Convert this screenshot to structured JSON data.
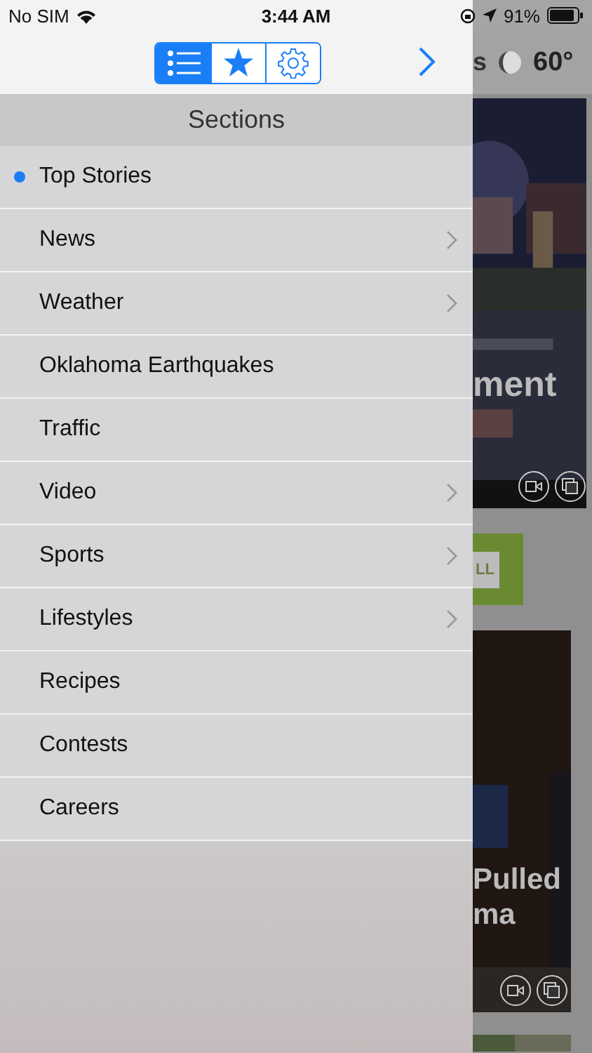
{
  "status_bar": {
    "carrier": "No SIM",
    "time": "3:44 AM",
    "battery": "91%"
  },
  "toolbar": {
    "segments": [
      {
        "kind": "list",
        "selected": true
      },
      {
        "kind": "star",
        "selected": false
      },
      {
        "kind": "gear",
        "selected": false
      }
    ]
  },
  "header": "Sections",
  "items": [
    {
      "label": "Top Stories",
      "selected": true,
      "has_children": false
    },
    {
      "label": "News",
      "selected": false,
      "has_children": true
    },
    {
      "label": "Weather",
      "selected": false,
      "has_children": true
    },
    {
      "label": "Oklahoma Earthquakes",
      "selected": false,
      "has_children": false
    },
    {
      "label": "Traffic",
      "selected": false,
      "has_children": false
    },
    {
      "label": "Video",
      "selected": false,
      "has_children": true
    },
    {
      "label": "Sports",
      "selected": false,
      "has_children": true
    },
    {
      "label": "Lifestyles",
      "selected": false,
      "has_children": true
    },
    {
      "label": "Recipes",
      "selected": false,
      "has_children": false
    },
    {
      "label": "Contests",
      "selected": false,
      "has_children": false
    },
    {
      "label": "Careers",
      "selected": false,
      "has_children": false
    }
  ],
  "background": {
    "title_fragment": "s",
    "temperature": "60°",
    "story_1_headline": "ment",
    "button_fragment": "LL",
    "story_2_headline": [
      "Pulled",
      "ma"
    ]
  }
}
